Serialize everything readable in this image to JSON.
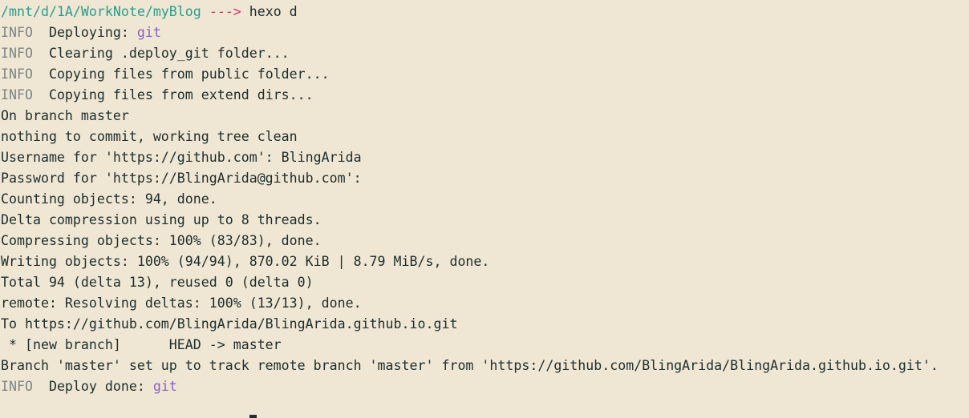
{
  "prompt": {
    "path": "/mnt/d/1A/WorkNote/myBlog",
    "arrow": "--->",
    "command": "hexo d"
  },
  "log": {
    "tag": "INFO",
    "deploying_label": "Deploying:",
    "deploy_target": "git",
    "clearing": "Clearing .deploy_git folder...",
    "copy_public": "Copying files from public folder...",
    "copy_extend": "Copying files from extend dirs...",
    "done_label": "Deploy done:",
    "done_target": "git"
  },
  "output": [
    "On branch master",
    "nothing to commit, working tree clean",
    "Username for 'https://github.com': BlingArida",
    "Password for 'https://BlingArida@github.com':",
    "Counting objects: 94, done.",
    "Delta compression using up to 8 threads.",
    "Compressing objects: 100% (83/83), done.",
    "Writing objects: 100% (94/94), 870.02 KiB | 8.79 MiB/s, done.",
    "Total 94 (delta 13), reused 0 (delta 0)",
    "remote: Resolving deltas: 100% (13/13), done.",
    "To https://github.com/BlingArida/BlingArida.github.io.git",
    " * [new branch]      HEAD -> master",
    "Branch 'master' set up to track remote branch 'master' from 'https://github.com/BlingArida/BlingArida.github.io.git'."
  ],
  "colors": {
    "background": "#efe6d4",
    "text": "#1d2e2c",
    "path": "#2a9d8a",
    "arrow": "#d6336c",
    "info_tag": "#7e8686",
    "git_keyword": "#8a60c4"
  }
}
